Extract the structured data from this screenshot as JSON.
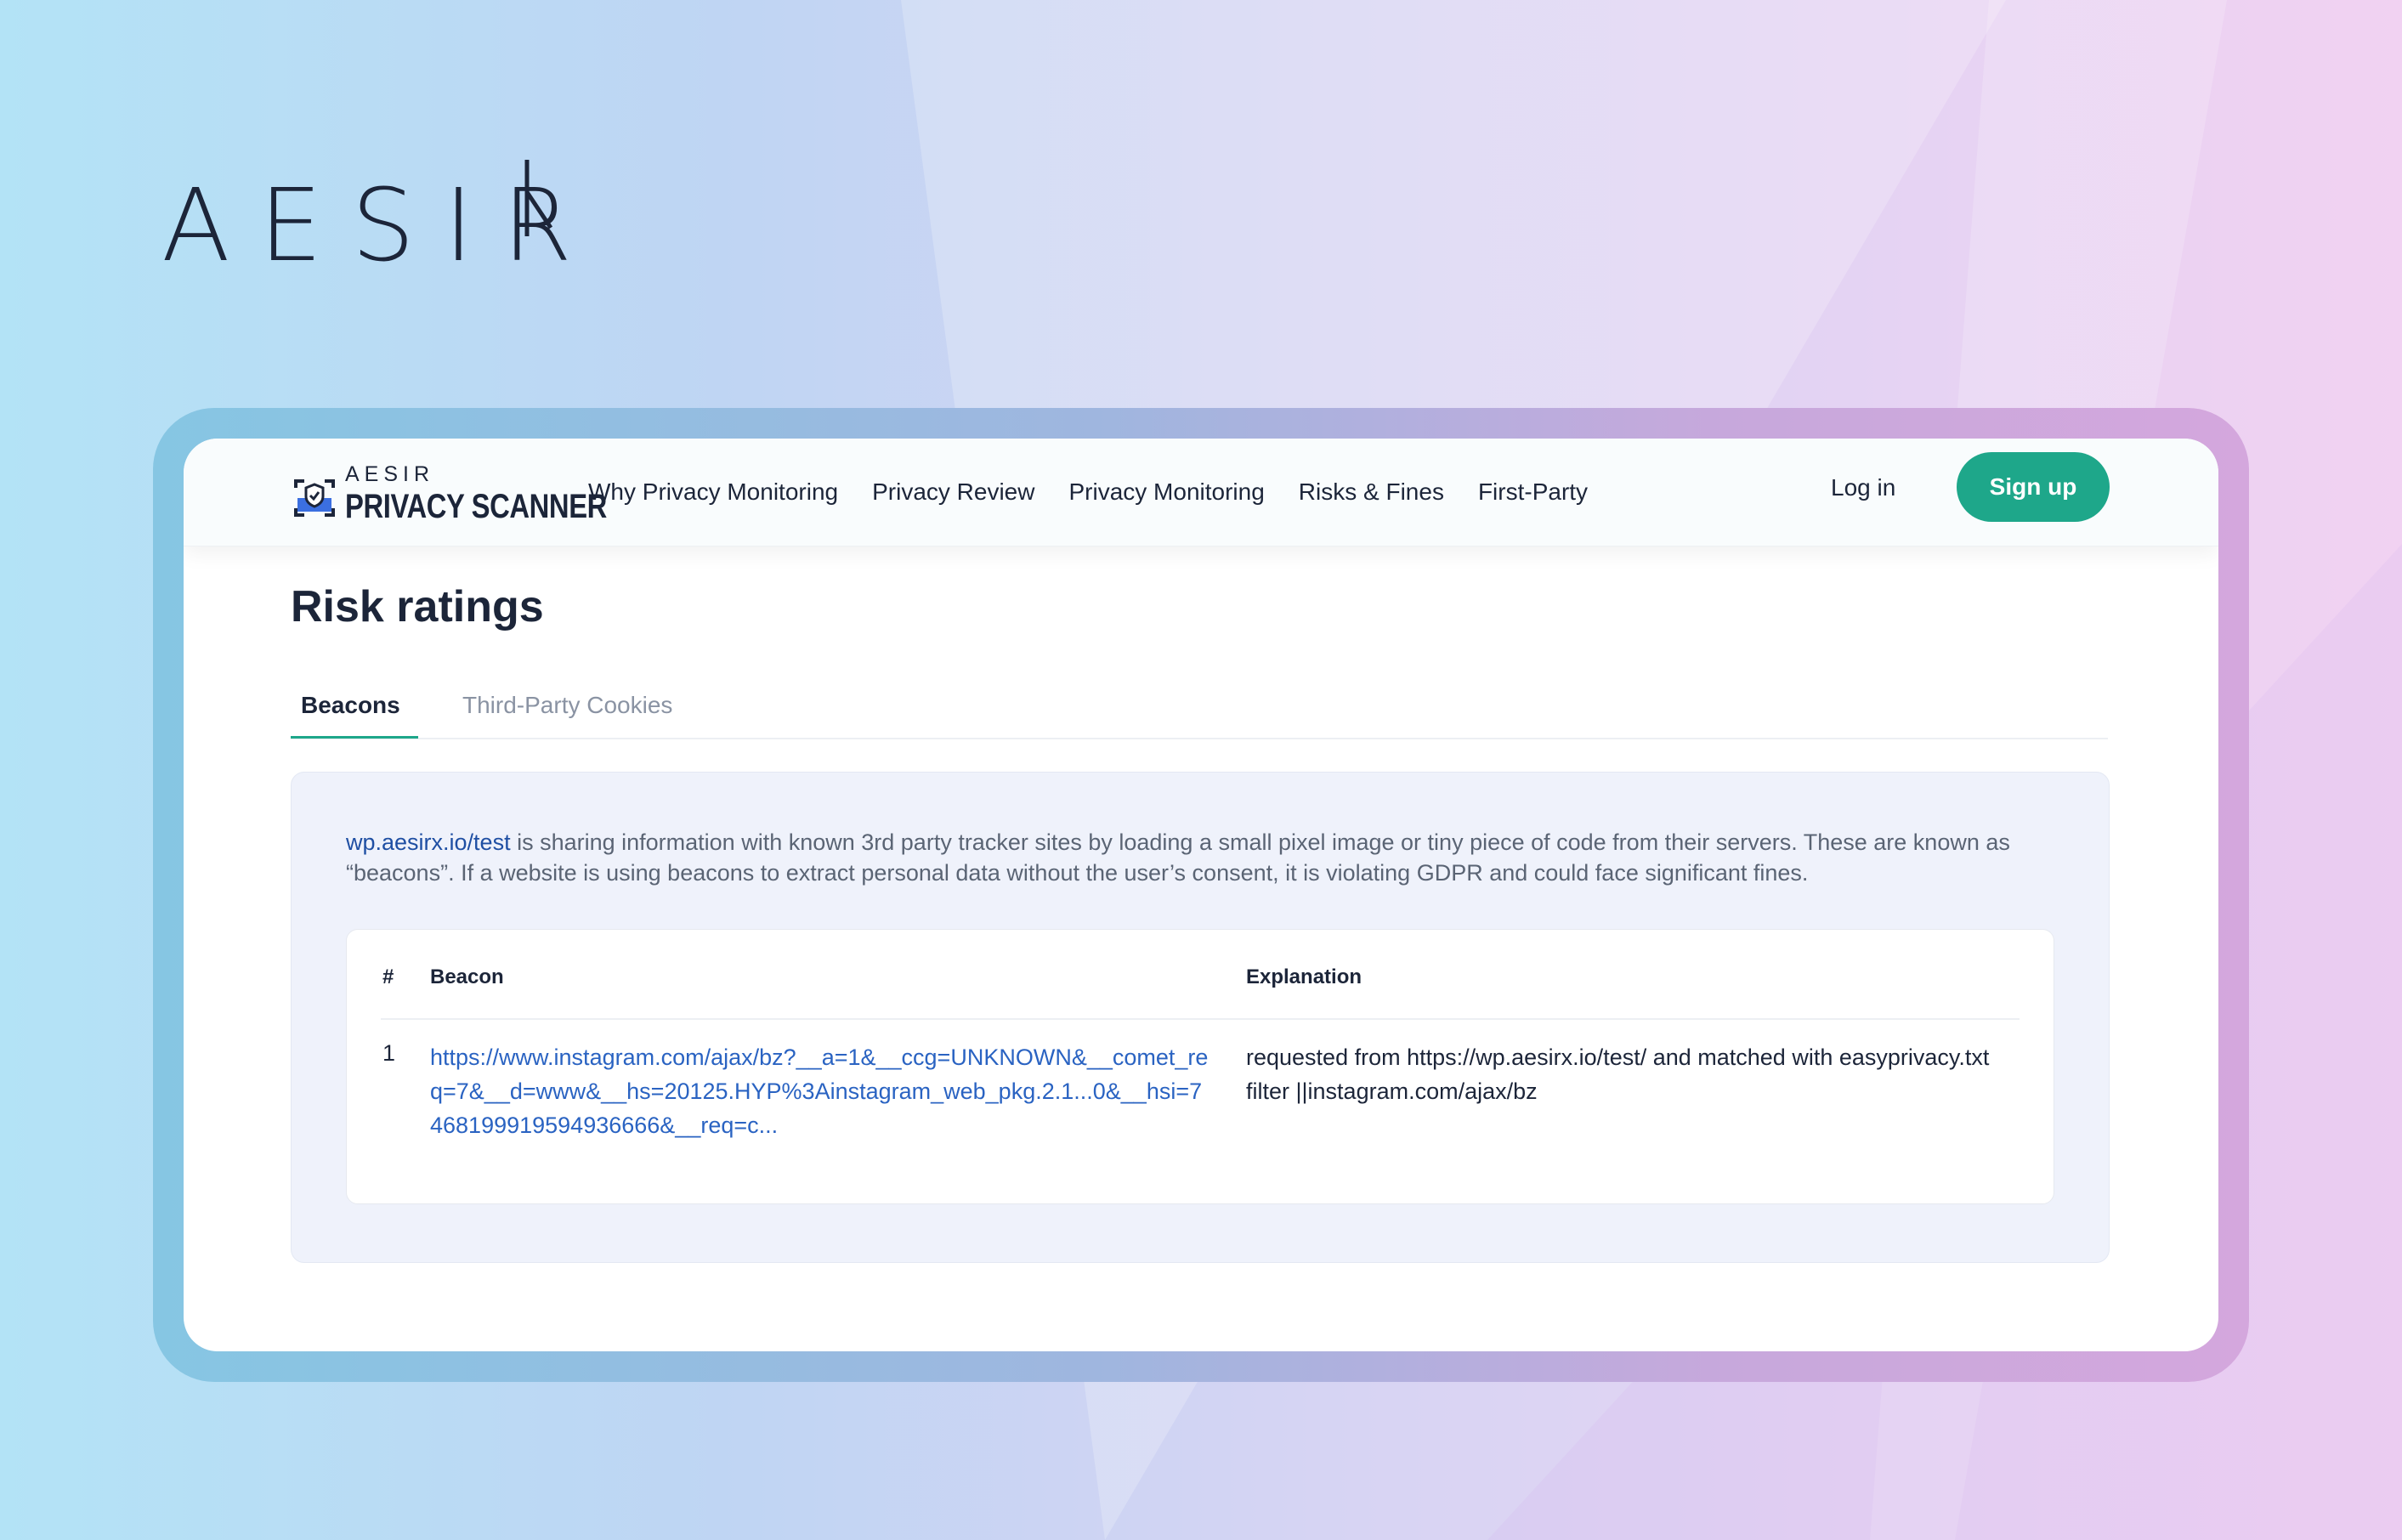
{
  "brand": {
    "wordmark": "AESIR",
    "accent_color": "#1c2539"
  },
  "nav": {
    "logo_top": "AESIR",
    "logo_main": "PRIVACY SCANNER",
    "links": [
      "Why Privacy Monitoring",
      "Privacy Review",
      "Privacy Monitoring",
      "Risks & Fines",
      "First-Party"
    ],
    "login": "Log in",
    "signup": "Sign up"
  },
  "page": {
    "title": "Risk ratings"
  },
  "tabs": {
    "active": "Beacons",
    "inactive": "Third-Party Cookies"
  },
  "intro": {
    "site": "wp.aesirx.io/test",
    "text": " is sharing information with known 3rd party tracker sites by loading a small pixel image or tiny piece of code from their servers. These are known as “beacons”. If a website is using beacons to extract personal data without the user’s consent, it is violating GDPR and could face significant fines."
  },
  "table": {
    "headers": {
      "num": "#",
      "beacon": "Beacon",
      "explanation": "Explanation"
    },
    "rows": [
      {
        "num": "1",
        "beacon": "https://www.instagram.com/ajax/bz?__a=1&__ccg=UNKNOWN&__comet_req=7&__d=www&__hs=20125.HYP%3Ainstagram_web_pkg.2.1...0&__hsi=7468199919594936666&__req=c...",
        "explanation": "requested from https://wp.aesirx.io/test/ and matched with easyprivacy.txt filter ||instagram.com/ajax/bz"
      }
    ]
  },
  "colors": {
    "primary_green": "#1ea78a",
    "link_blue": "#2a63c2",
    "text_dark": "#1c2539"
  }
}
